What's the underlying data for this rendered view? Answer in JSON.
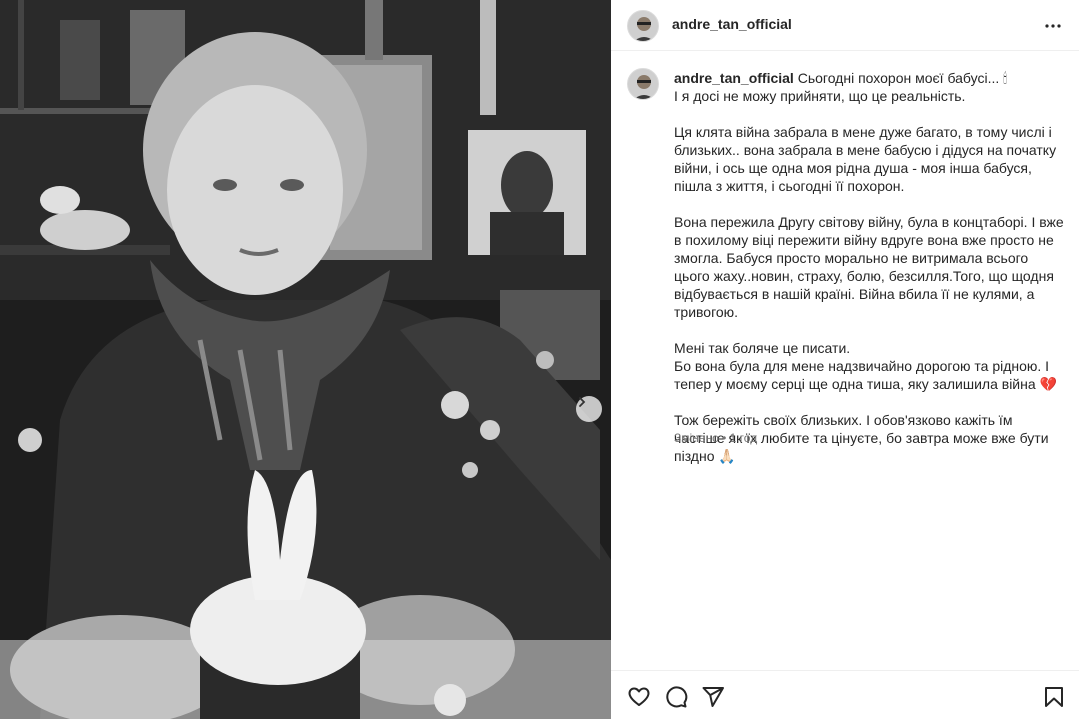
{
  "post": {
    "username": "andre_tan_official",
    "caption_first": "Сьогодні похорон моєї бабусі... 🕯",
    "caption_lines": [
      "І я досі не можу прийняти, що це реальність.",
      "",
      "Ця клята війна забрала в мене дуже багато, в тому числі і близьких.. вона забрала в мене бабусю і дідуся на початку війни, і ось ще одна моя рідна душа - моя інша бабуся, пішла з життя, і сьогодні її похорон.",
      "",
      "Вона пережила Другу світову війну, була в концтаборі. І вже в похилому віці пережити війну вдруге вона вже просто не змогла. Бабуся просто морально не витримала всього цього жаху..новин, страху, болю, безсилля.Того, що щодня відбувається в нашій країні. Війна вбила її не кулями, а тривогою.",
      "",
      "Мені так боляче це писати.",
      "Бо вона була для мене надзвичайно дорогою та рідною. І тепер у моєму серці ще одна тиша, яку залишила війна 💔",
      "",
      "Тож бережіть своїх близьких. І обов'язково кажіть їм частіше як їх любите та цінуєте, бо завтра може вже бути піздно 🙏🏻"
    ],
    "edited_label": "Змінено",
    "separator": "•",
    "time_ago": "1 год"
  },
  "icons": {
    "more": "more-horizontal-icon",
    "like": "heart-icon",
    "comment": "comment-icon",
    "share": "send-icon",
    "save": "bookmark-icon",
    "next": "chevron-right-icon"
  },
  "colors": {
    "text": "#262626",
    "muted": "#737373",
    "divider": "#efefef"
  }
}
